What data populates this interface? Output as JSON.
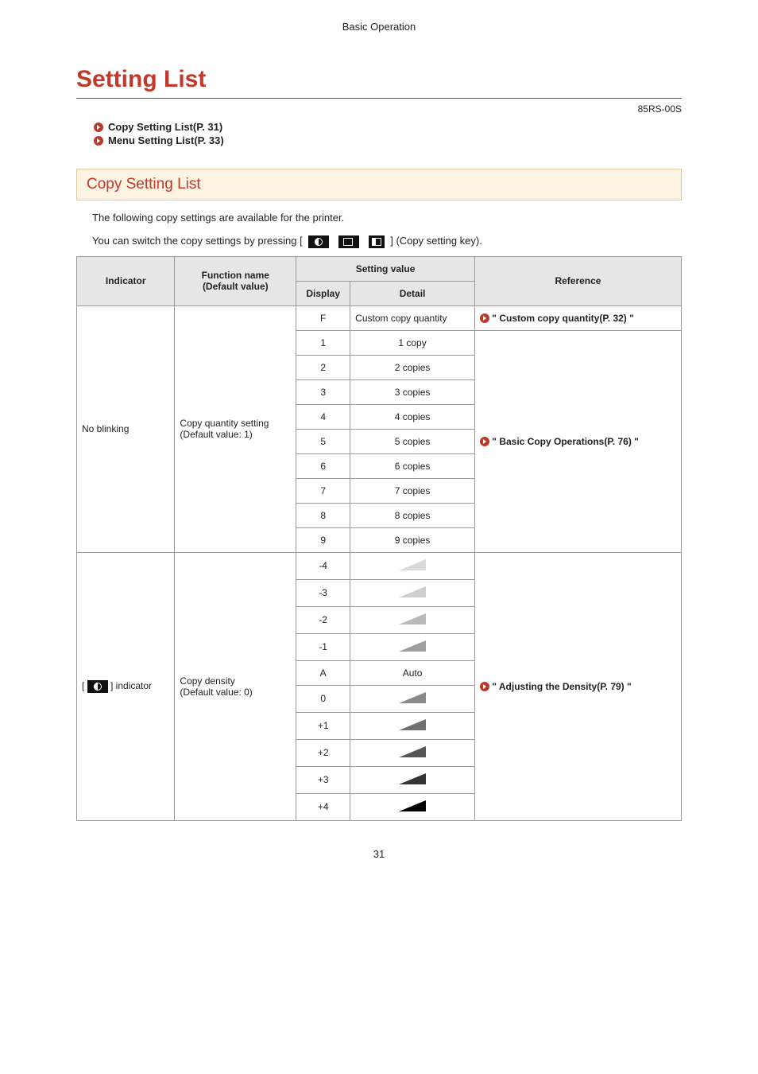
{
  "header": {
    "running_title": "Basic Operation"
  },
  "h1": "Setting List",
  "code": "85RS-00S",
  "toc": [
    {
      "label": "Copy Setting List(P. 31)"
    },
    {
      "label": "Menu Setting List(P. 33)"
    }
  ],
  "h2": "Copy Setting List",
  "intro_1": "The following copy settings are available for the printer.",
  "intro_2a": "You can switch the copy settings by pressing [",
  "intro_2b": "] (Copy setting key).",
  "table": {
    "headers": {
      "indicator": "Indicator",
      "func": "Function name\n(Default value)",
      "setting": "Setting value",
      "display": "Display",
      "detail": "Detail",
      "reference": "Reference"
    },
    "group1": {
      "indicator": "No blinking",
      "func_line1": "Copy quantity setting",
      "func_line2": "(Default value: 1)",
      "rows": [
        {
          "display": "F",
          "detail": "Custom copy quantity"
        },
        {
          "display": "1",
          "detail": "1 copy"
        },
        {
          "display": "2",
          "detail": "2 copies"
        },
        {
          "display": "3",
          "detail": "3 copies"
        },
        {
          "display": "4",
          "detail": "4 copies"
        },
        {
          "display": "5",
          "detail": "5 copies"
        },
        {
          "display": "6",
          "detail": "6 copies"
        },
        {
          "display": "7",
          "detail": "7 copies"
        },
        {
          "display": "8",
          "detail": "8 copies"
        },
        {
          "display": "9",
          "detail": "9 copies"
        }
      ],
      "ref1": "\" Custom copy quantity(P. 32) \"",
      "ref2": "\" Basic Copy Operations(P. 76) \""
    },
    "group2": {
      "indicator_suffix": "] indicator",
      "func_line1": "Copy density",
      "func_line2": "(Default value: 0)",
      "ref": "\" Adjusting the Density(P. 79) \"",
      "rows": [
        {
          "display": "-4",
          "cls": "lvl-n4"
        },
        {
          "display": "-3",
          "cls": "lvl-n3"
        },
        {
          "display": "-2",
          "cls": "lvl-n2"
        },
        {
          "display": "-1",
          "cls": "lvl-n1"
        },
        {
          "display": "A",
          "detail": "Auto"
        },
        {
          "display": "0",
          "cls": "lvl-0"
        },
        {
          "display": "+1",
          "cls": "lvl-p1"
        },
        {
          "display": "+2",
          "cls": "lvl-p2"
        },
        {
          "display": "+3",
          "cls": "lvl-p3"
        },
        {
          "display": "+4",
          "cls": "lvl-p4"
        }
      ]
    }
  },
  "page_number": "31"
}
